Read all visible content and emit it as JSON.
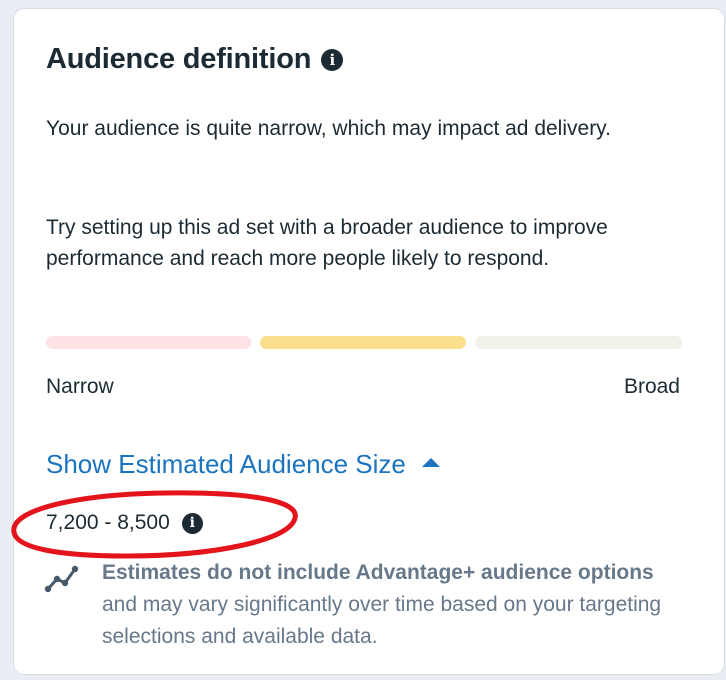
{
  "card": {
    "title": "Audience definition",
    "info_icon": "info-icon",
    "paragraph_1": "Your audience is quite narrow, which may impact ad delivery.",
    "paragraph_2": "Try setting up this ad set with a broader audience to improve performance and reach more people likely to respond."
  },
  "audience_meter": {
    "left_label": "Narrow",
    "right_label": "Broad",
    "active_segment": 2,
    "segment_colors": [
      "#fde3e5",
      "#fbdf8c",
      "#eff3ea"
    ]
  },
  "estimated_size": {
    "toggle_label": "Show Estimated Audience Size",
    "toggle_icon": "caret-up-icon",
    "range": "7,200 - 8,500",
    "annotation_color": "#e3141b"
  },
  "disclaimer": {
    "icon": "trend-line-icon",
    "bold_text": "Estimates do not include Advantage+ audience options",
    "rest_text": " and may vary significantly over time based on your targeting selections and available data."
  },
  "colors": {
    "link": "#1b74c0",
    "text": "#1c2b33",
    "muted": "#67788a"
  }
}
